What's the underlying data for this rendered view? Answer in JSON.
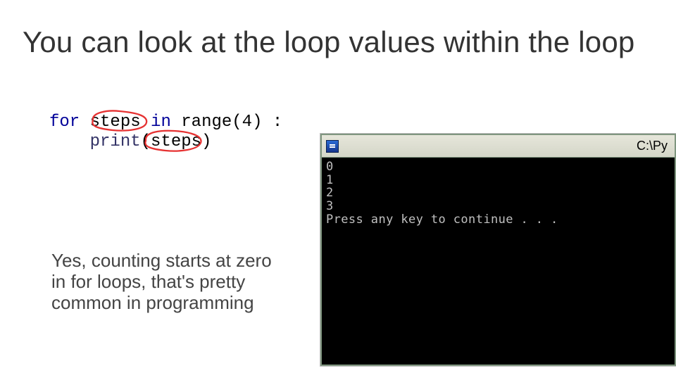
{
  "title": "You can look at the loop values within the loop",
  "code": {
    "kw_for": "for",
    "var1": " steps ",
    "kw_in": "in",
    "range_call": " range(4) :",
    "indent": "    ",
    "print_fn": "print",
    "print_args": "(steps)"
  },
  "note": "Yes, counting starts at zero in for loops, that's pretty common in programming",
  "terminal": {
    "title": "C:\\Py",
    "lines": [
      "0",
      "1",
      "2",
      "3",
      "Press any key to continue . . ."
    ]
  }
}
